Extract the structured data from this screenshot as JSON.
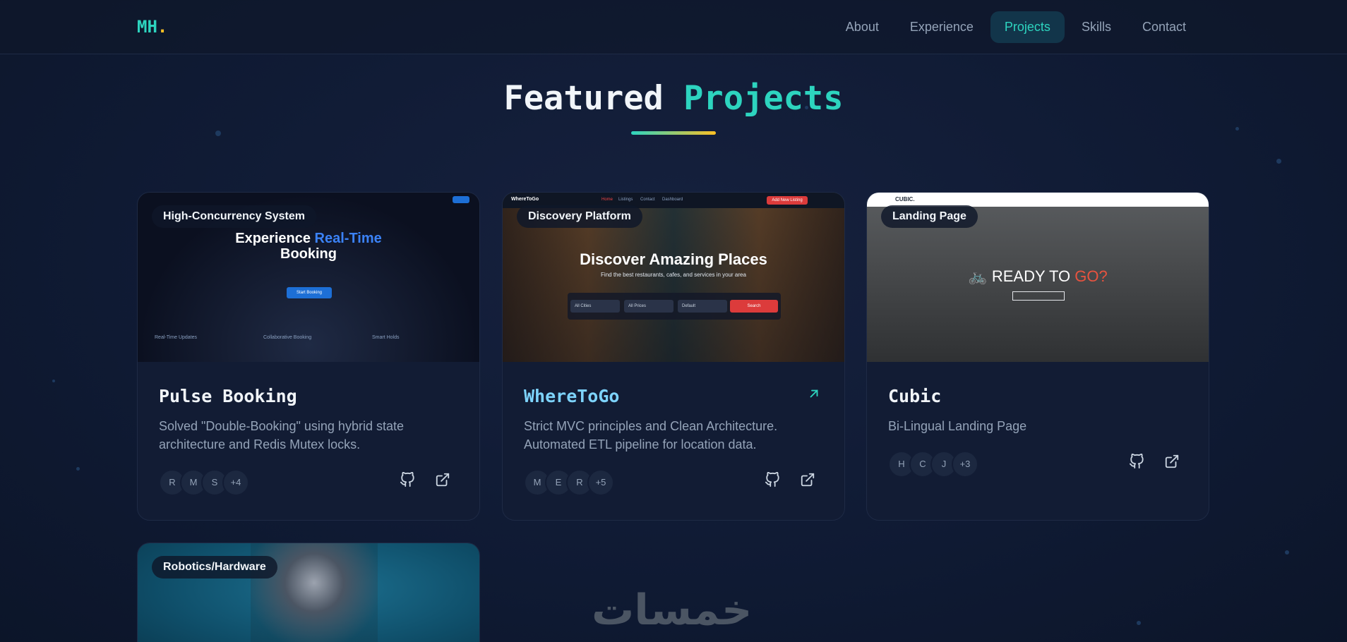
{
  "nav": {
    "logo": "MH",
    "logo_dot": ".",
    "links": [
      "About",
      "Experience",
      "Projects",
      "Skills",
      "Contact"
    ],
    "active": "Projects"
  },
  "section": {
    "title_main": "Featured",
    "title_accent": "Projects"
  },
  "projects": [
    {
      "badge": "High-Concurrency System",
      "title": "Pulse Booking",
      "description": "Solved \"Double-Booking\" using hybrid state architecture and Redis Mutex locks.",
      "tech": [
        "R",
        "M",
        "S",
        "+4"
      ],
      "thumb": {
        "hero_line1": "Experience",
        "hero_accent": "Real-Time",
        "hero_line2": "Booking",
        "cta": "Start Booking",
        "features": [
          "Real-Time Updates",
          "Collaborative Booking",
          "Smart Holds"
        ]
      }
    },
    {
      "badge": "Discovery Platform",
      "title": "WhereToGo",
      "description": "Strict MVC principles and Clean Architecture. Automated ETL pipeline for location data.",
      "tech": [
        "M",
        "E",
        "R",
        "+5"
      ],
      "thumb": {
        "brand": "WhereToGo",
        "menu": [
          "Home",
          "Listings",
          "Contact",
          "Dashboard"
        ],
        "add_listing": "Add New Listing",
        "hero": "Discover Amazing Places",
        "sub": "Find the best restaurants, cafes, and services in your area",
        "fields": [
          "All Cities",
          "All Prices",
          "Default"
        ],
        "field_labels": [
          "City",
          "Price Range",
          "Sort by"
        ],
        "search": "Search"
      }
    },
    {
      "badge": "Landing Page",
      "title": "Cubic",
      "description": "Bi-Lingual Landing Page",
      "tech": [
        "H",
        "C",
        "J",
        "+3"
      ],
      "thumb": {
        "brand": "CUBIC.",
        "hero_a": "READY TO",
        "hero_b": "GO?"
      }
    },
    {
      "badge": "Robotics/Hardware"
    }
  ],
  "watermark": "خمسات",
  "colors": {
    "accent": "#2dd4bf",
    "gold": "#fbbf24",
    "bg": "#0f1a33",
    "card": "#121c34"
  }
}
